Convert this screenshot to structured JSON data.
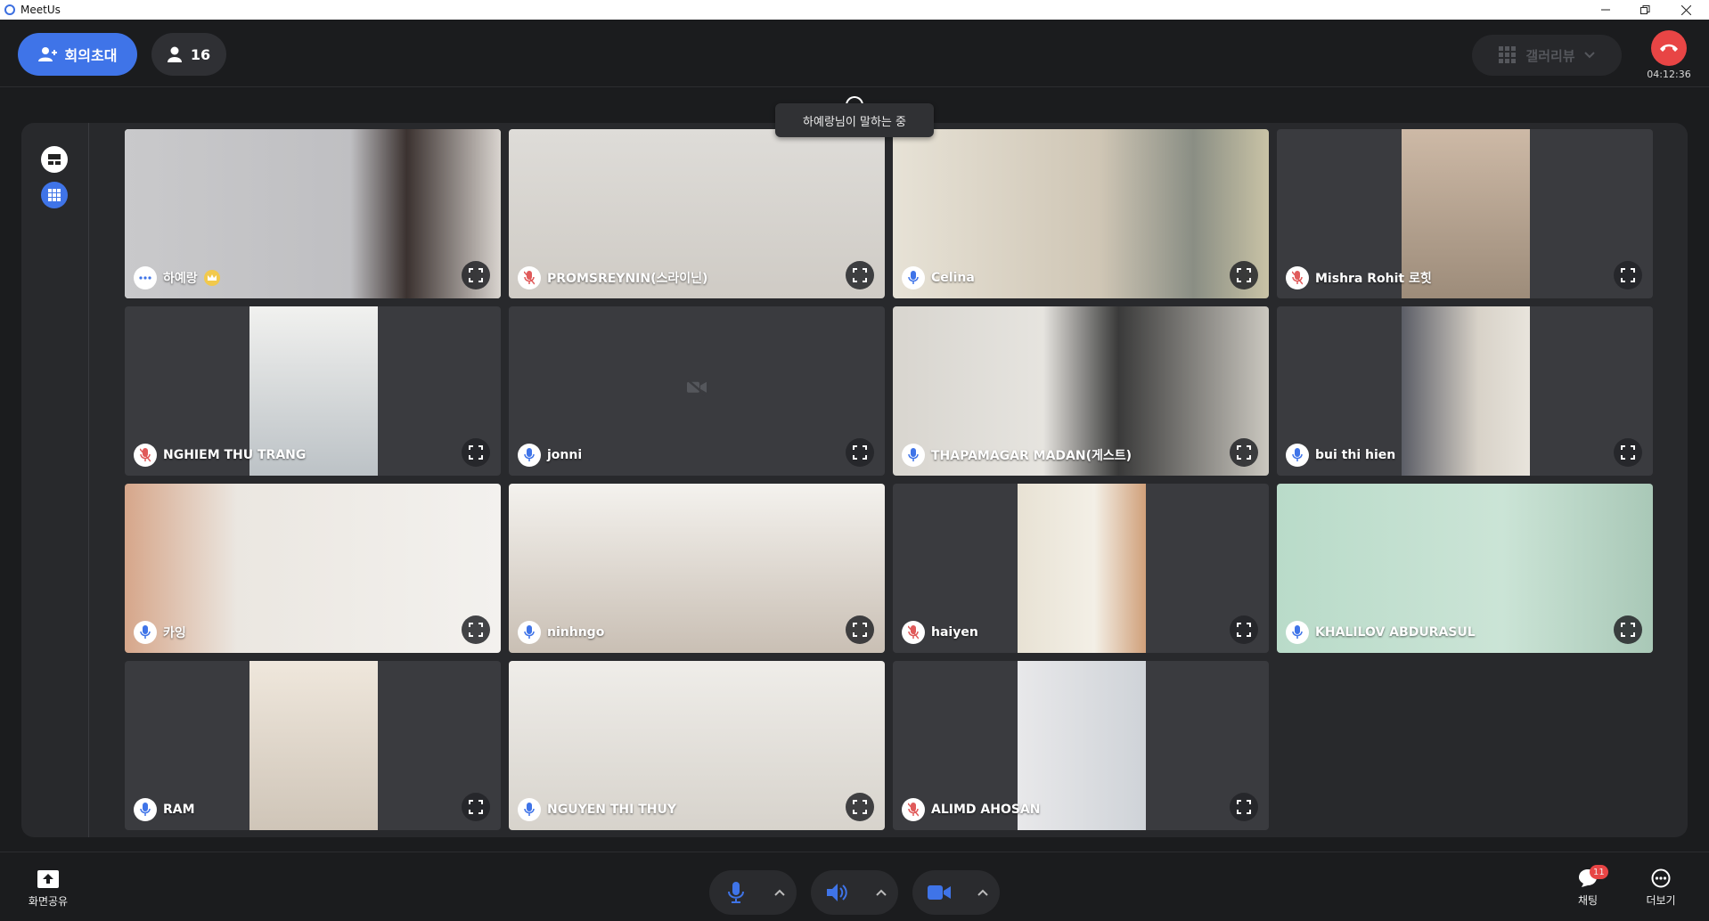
{
  "window": {
    "title": "MeetUs"
  },
  "header": {
    "invite_label": "회의초대",
    "participants_count": "16",
    "view_mode_label": "갤러리뷰",
    "elapsed_time": "04:12:36"
  },
  "speaking_tooltip": "하예랑님이 말하는 중",
  "participants": [
    {
      "name": "하예랑",
      "mic": "dots",
      "host": true,
      "video": true,
      "active": true
    },
    {
      "name": "PROMSREYNIN(스라이닌)",
      "mic": "muted",
      "video": true
    },
    {
      "name": "Celina",
      "mic": "on",
      "video": true
    },
    {
      "name": "Mishra Rohit 로힛",
      "mic": "muted",
      "video": true
    },
    {
      "name": "NGHIEM THU TRANG",
      "mic": "muted",
      "video": true
    },
    {
      "name": "jonni",
      "mic": "on",
      "video": false
    },
    {
      "name": "THAPAMAGAR MADAN(게스트)",
      "mic": "on",
      "video": true
    },
    {
      "name": "bui thi hien",
      "mic": "on",
      "video": true
    },
    {
      "name": "카잉",
      "mic": "on",
      "video": true
    },
    {
      "name": "ninhngo",
      "mic": "on",
      "video": true
    },
    {
      "name": "haiyen",
      "mic": "muted",
      "video": true
    },
    {
      "name": "KHALILOV ABDURASUL",
      "mic": "on",
      "video": true
    },
    {
      "name": "RAM",
      "mic": "on",
      "video": true
    },
    {
      "name": "NGUYEN THI THUY",
      "mic": "on",
      "video": true
    },
    {
      "name": "ALIMD AHOSAN",
      "mic": "muted",
      "video": true
    }
  ],
  "bottom": {
    "share_label": "화면공유",
    "chat_label": "채팅",
    "chat_badge": "11",
    "more_label": "더보기"
  },
  "colors": {
    "accent": "#3f74e8",
    "danger": "#e84545",
    "muted_mic": "#e05a5a"
  }
}
